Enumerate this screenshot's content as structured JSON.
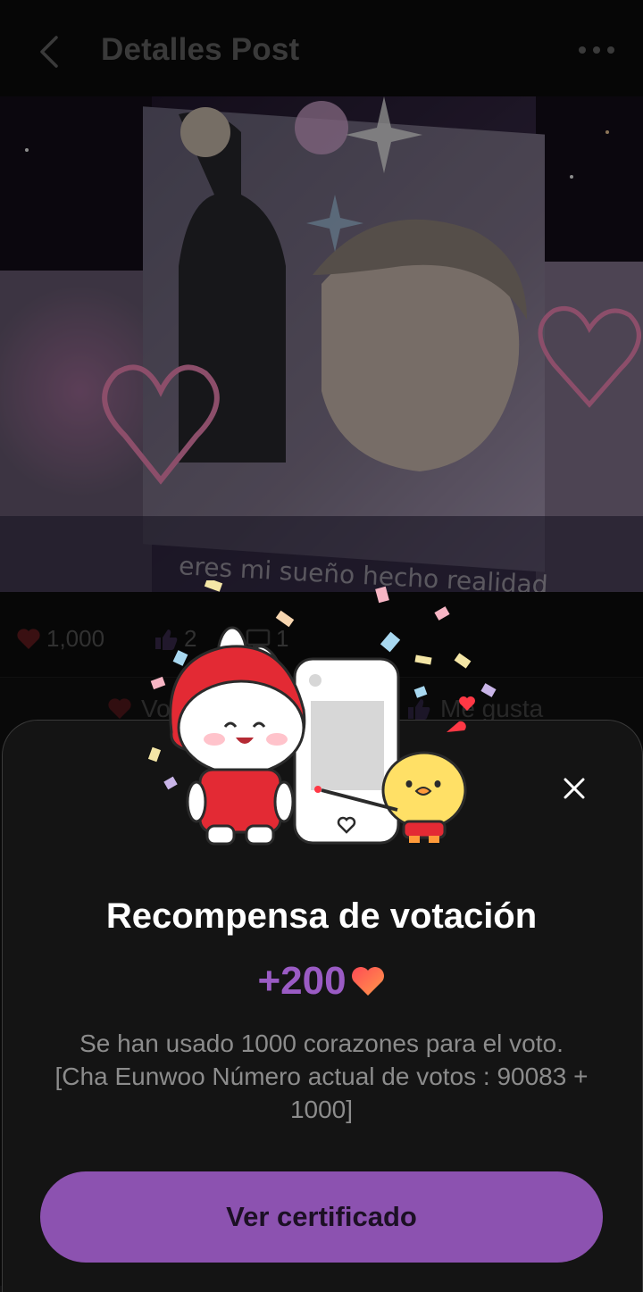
{
  "header": {
    "title": "Detalles Post"
  },
  "media": {
    "caption": "eres mi sueño hecho realidad"
  },
  "stats": {
    "hearts": "1,000",
    "likes": "2",
    "comments": "1"
  },
  "actions": {
    "vote_label": "Vo",
    "like_label": "Me gusta"
  },
  "sheet": {
    "title": "Recompensa de votación",
    "reward_amount": "+200",
    "description_line1": "Se han usado 1000 corazones para el voto.",
    "description_line2": "[Cha Eunwoo Número actual de votos : 90083 +",
    "description_line3": "1000]",
    "cta_label": "Ver certificado"
  },
  "colors": {
    "accent_purple": "#8c52b0",
    "reward_purple": "#9a5bc4",
    "heart_red": "#e0393e"
  }
}
